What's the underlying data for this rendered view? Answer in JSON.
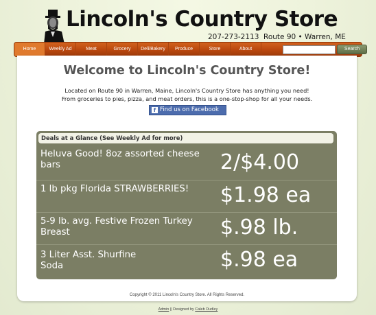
{
  "header": {
    "logo_text": "Lincoln's Country Store",
    "phone": "207-273-2113",
    "address": "Route 90 • Warren, ME"
  },
  "nav": {
    "items": [
      {
        "label": "Home",
        "active": true
      },
      {
        "label": "Weekly Ad"
      },
      {
        "label": "Meat"
      },
      {
        "label": "Grocery"
      },
      {
        "label": "Deli/Bakery"
      },
      {
        "label": "Produce"
      },
      {
        "label": "Store"
      },
      {
        "label": "About"
      }
    ],
    "search": {
      "value": "",
      "placeholder": "",
      "button_label": "Search"
    }
  },
  "main": {
    "welcome": "Welcome to Lincoln's Country Store!",
    "intro_line1": "Located on Route 90 in Warren, Maine, Lincoln's Country Store has anything you need!",
    "intro_line2": "From groceries to pies, pizza, and meat orders, this is a one-stop-shop for all your needs.",
    "facebook_label": "Find us on Facebook"
  },
  "deals": {
    "heading": "Deals at a Glance (See Weekly Ad for more)",
    "items": [
      {
        "description": "Heluva Good! 8oz assorted cheese bars",
        "price": "2/$4.00"
      },
      {
        "description": "1 lb pkg Florida STRAWBERRIES!",
        "price": "$1.98 ea"
      },
      {
        "description": "5-9 lb. avg. Festive Frozen Turkey Breast",
        "price": "$.98 lb."
      },
      {
        "description": "3 Liter Asst. Shurfine Soda",
        "price": "$.98 ea"
      }
    ]
  },
  "footer": {
    "copyright": "Copyright © 2011 Lincoln's Country Store. All Rights Reserved.",
    "admin_link": "Admin",
    "designed_by_text": " || Designed by ",
    "designer_link": "Caleb Dudley"
  },
  "colors": {
    "nav_orange": "#b9470e",
    "deals_bg": "#7b7e64",
    "facebook_blue": "#4c6cad"
  }
}
